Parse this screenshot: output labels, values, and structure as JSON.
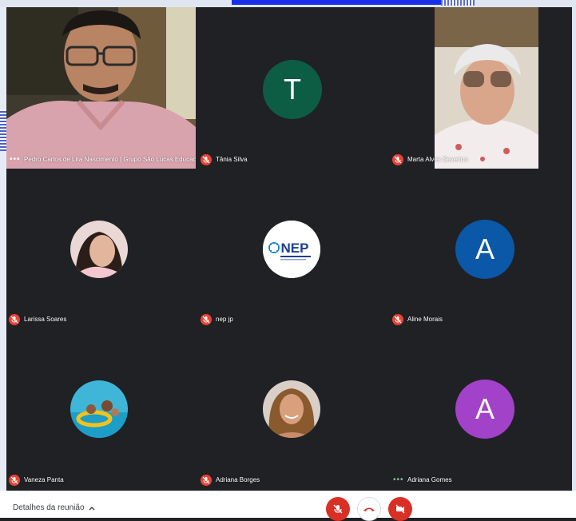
{
  "participants": [
    {
      "name": "Pedro Carlos de Lira Nascimento | Grupo São Lucas Educacio...",
      "mic": "more"
    },
    {
      "name": "Tânia Silva",
      "mic": "muted",
      "initial": "T",
      "color": "#0d5d45"
    },
    {
      "name": "Marta Alves Severino",
      "mic": "muted"
    },
    {
      "name": "Larissa Soares",
      "mic": "muted"
    },
    {
      "name": "nep jp",
      "mic": "muted",
      "logo_text": "NEP"
    },
    {
      "name": "Aline Morais",
      "mic": "muted",
      "initial": "A",
      "color": "#0b57a8"
    },
    {
      "name": "Vaneza Panta",
      "mic": "muted"
    },
    {
      "name": "Adriana Borges",
      "mic": "muted"
    },
    {
      "name": "Adriana Gomes",
      "mic": "speaking",
      "initial": "A",
      "color": "#a142c9"
    }
  ],
  "bottom_bar": {
    "details_label": "Detalhes da reunião",
    "controls": [
      "mic-off-icon",
      "end-call-icon",
      "camera-off-icon"
    ],
    "accent_red": "#d93025"
  },
  "icons": {
    "more": "more-options-icon",
    "muted": "mic-off-icon",
    "chevron": "chevron-up-icon"
  },
  "theme": {
    "background": "#202124",
    "tile": "#3c4043"
  }
}
